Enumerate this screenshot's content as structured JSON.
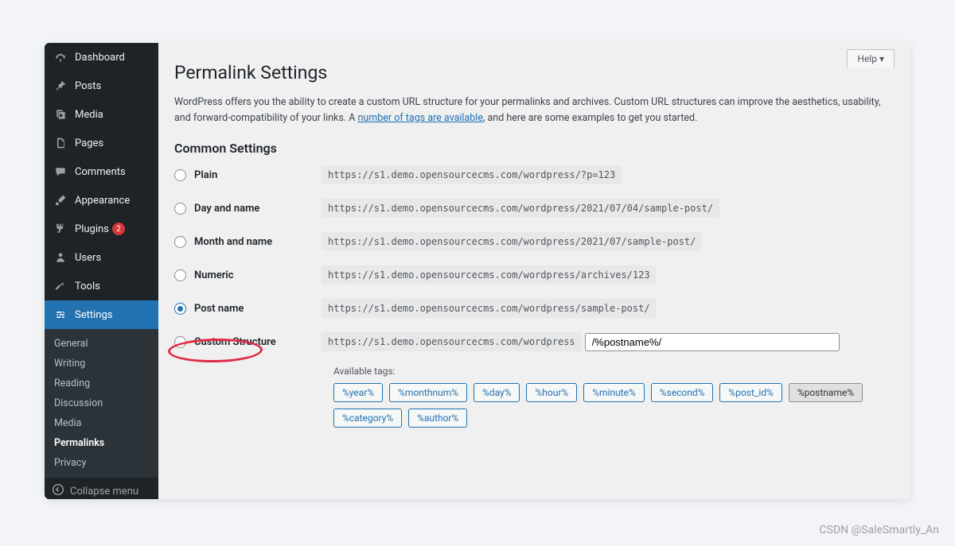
{
  "sidebar": {
    "items": [
      {
        "label": "Dashboard",
        "icon": "dashboard"
      },
      {
        "label": "Posts",
        "icon": "pin"
      },
      {
        "label": "Media",
        "icon": "media"
      },
      {
        "label": "Pages",
        "icon": "pages"
      },
      {
        "label": "Comments",
        "icon": "comment"
      },
      {
        "label": "Appearance",
        "icon": "brush"
      },
      {
        "label": "Plugins",
        "icon": "plug",
        "badge": "2"
      },
      {
        "label": "Users",
        "icon": "user"
      },
      {
        "label": "Tools",
        "icon": "wrench"
      },
      {
        "label": "Settings",
        "icon": "sliders",
        "active": true
      }
    ],
    "submenu": [
      {
        "label": "General"
      },
      {
        "label": "Writing"
      },
      {
        "label": "Reading"
      },
      {
        "label": "Discussion"
      },
      {
        "label": "Media"
      },
      {
        "label": "Permalinks",
        "current": true
      },
      {
        "label": "Privacy"
      }
    ],
    "collapse_label": "Collapse menu"
  },
  "help_label": "Help ▾",
  "page_title": "Permalink Settings",
  "intro": {
    "part1": "WordPress offers you the ability to create a custom URL structure for your permalinks and archives. Custom URL structures can improve the aesthetics, usability, and forward-compatibility of your links. A ",
    "link": "number of tags are available",
    "part2": ", and here are some examples to get you started."
  },
  "section_label": "Common Settings",
  "options": {
    "plain": {
      "label": "Plain",
      "url": "https://s1.demo.opensourcecms.com/wordpress/?p=123"
    },
    "dayname": {
      "label": "Day and name",
      "url": "https://s1.demo.opensourcecms.com/wordpress/2021/07/04/sample-post/"
    },
    "monthname": {
      "label": "Month and name",
      "url": "https://s1.demo.opensourcecms.com/wordpress/2021/07/sample-post/"
    },
    "numeric": {
      "label": "Numeric",
      "url": "https://s1.demo.opensourcecms.com/wordpress/archives/123"
    },
    "postname": {
      "label": "Post name",
      "url": "https://s1.demo.opensourcecms.com/wordpress/sample-post/"
    },
    "custom": {
      "label": "Custom Structure",
      "base": "https://s1.demo.opensourcecms.com/wordpress",
      "value": "/%postname%/"
    }
  },
  "tags_label": "Available tags:",
  "tags": [
    "%year%",
    "%monthnum%",
    "%day%",
    "%hour%",
    "%minute%",
    "%second%",
    "%post_id%",
    "%postname%",
    "%category%",
    "%author%"
  ],
  "active_tag": "%postname%",
  "watermark": "CSDN @SaleSmartly_An"
}
